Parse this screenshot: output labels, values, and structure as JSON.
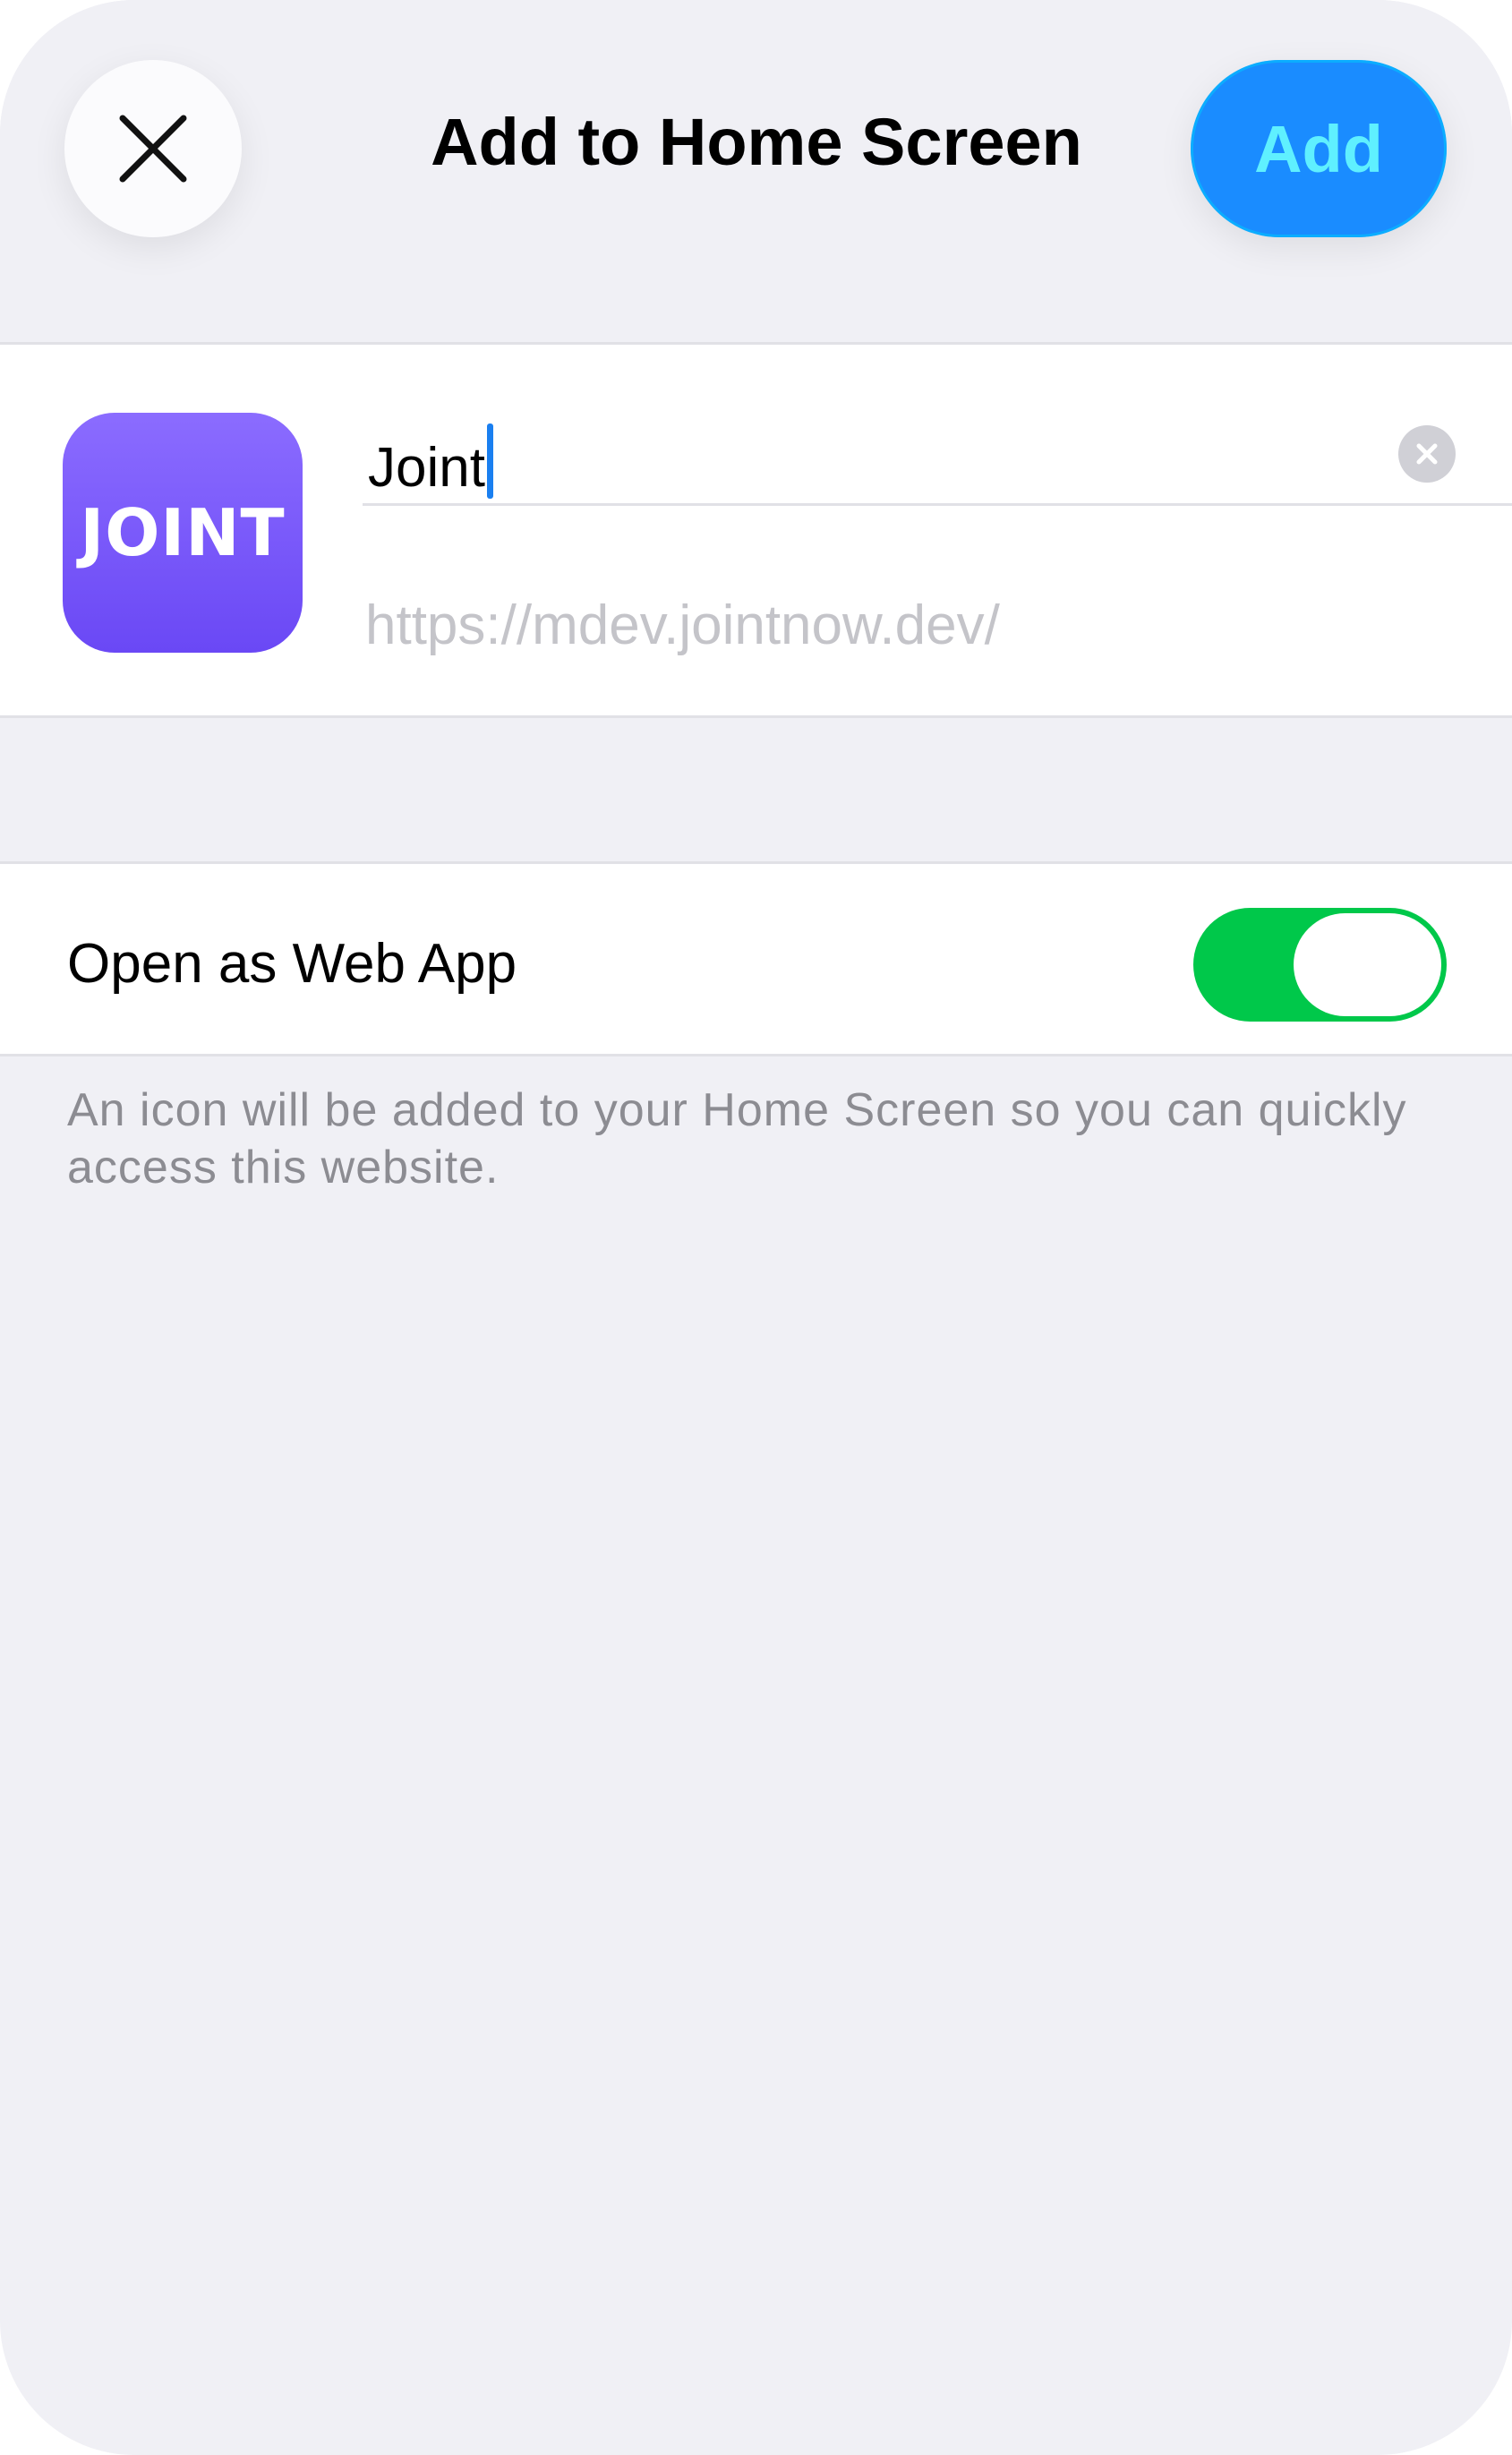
{
  "header": {
    "close_icon": "close-icon",
    "title": "Add to Home Screen",
    "add_label": "Add"
  },
  "app": {
    "icon_text": "JOINT",
    "icon_gradient": [
      "#8b6cff",
      "#6a48f5"
    ],
    "name_value": "Joint",
    "url": "https://mdev.jointnow.dev/",
    "clear_icon": "clear-circle-icon"
  },
  "web_app_option": {
    "label": "Open as Web App",
    "enabled": true,
    "on_color": "#00c84a"
  },
  "footnote": "An icon will be added to your Home Screen so you can quickly access this website.",
  "colors": {
    "background": "#f0f0f5",
    "accent": "#1a8cff",
    "add_text": "#5ff0ff",
    "caret": "#1a7ff0"
  }
}
